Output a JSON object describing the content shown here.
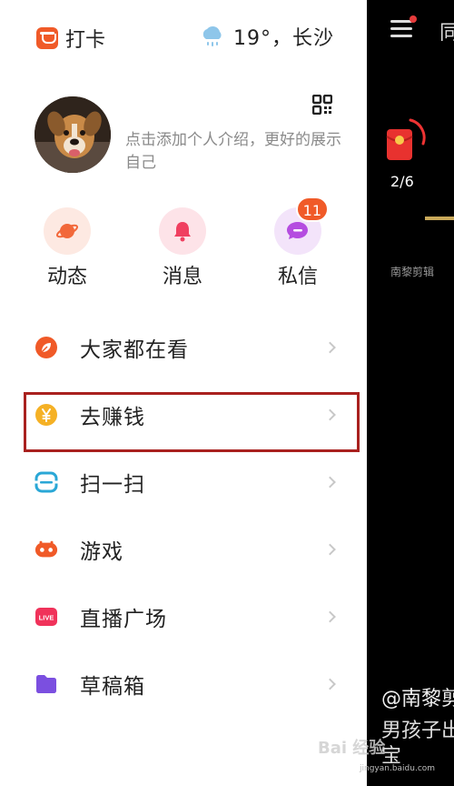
{
  "topbar": {
    "checkin_label": "打卡",
    "checkin_icon": "checkin-icon",
    "weather_icon": "cloud-rain-icon",
    "weather_text": "19°，长沙"
  },
  "profile": {
    "intro_text": "点击添加个人介绍，更好的展示自己",
    "qr_icon": "qr-code-icon"
  },
  "quick_actions": [
    {
      "label": "动态",
      "icon": "planet-icon",
      "color": "#f2683a"
    },
    {
      "label": "消息",
      "icon": "bell-icon",
      "color": "#f04060"
    },
    {
      "label": "私信",
      "icon": "chat-bubble-icon",
      "color": "#b54de0",
      "badge": "11"
    }
  ],
  "menu": [
    {
      "label": "大家都在看",
      "icon": "leaf-icon",
      "color": "#f05a28"
    },
    {
      "label": "去赚钱",
      "icon": "yen-coin-icon",
      "color": "#f5b125",
      "highlighted": true
    },
    {
      "label": "扫一扫",
      "icon": "scan-icon",
      "color": "#2aa7d6"
    },
    {
      "label": "游戏",
      "icon": "gamepad-icon",
      "color": "#f05a28"
    },
    {
      "label": "直播广场",
      "icon": "live-icon",
      "color": "#f0325a",
      "icon_text": "LIVE"
    },
    {
      "label": "草稿箱",
      "icon": "folder-icon",
      "color": "#7b4fe0"
    }
  ],
  "background": {
    "nav_peek": "同",
    "progress_text": "2/6",
    "author_peek": "南黎剪辑",
    "handle_peek": "@南黎剪",
    "caption_line1": "男孩子出",
    "caption_line2": "宝",
    "watermark": "Bai 经验",
    "watermark_url": "jingyan.baidu.com"
  },
  "colors": {
    "accent": "#f05a28",
    "highlight_border": "#a9211f",
    "badge": "#f05a28"
  }
}
